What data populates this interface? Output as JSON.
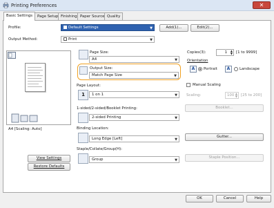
{
  "window": {
    "title": "Printing Preferences",
    "close_glyph": "✕"
  },
  "tabs": [
    {
      "label": "Basic Settings",
      "active": true
    },
    {
      "label": "Page Setup",
      "active": false
    },
    {
      "label": "Finishing",
      "active": false
    },
    {
      "label": "Paper Source",
      "active": false
    },
    {
      "label": "Quality",
      "active": false
    }
  ],
  "profile": {
    "label": "Profile:",
    "value": "Default Settings",
    "add_button": "Add(1)...",
    "edit_button": "Edit(2)..."
  },
  "output_method": {
    "label": "Output Method:",
    "value": "Print"
  },
  "preview": {
    "caption": "A4 [Scaling: Auto]",
    "view_settings_button": "View Settings",
    "restore_defaults_button": "Restore Defaults"
  },
  "page_size": {
    "label": "Page Size:",
    "value": "A4"
  },
  "output_size": {
    "label": "Output Size:",
    "value": "Match Page Size"
  },
  "copies": {
    "label": "Copies(3):",
    "value": "1",
    "range": "[1 to 9999]"
  },
  "orientation": {
    "label": "Orientation",
    "portrait": "Portrait",
    "landscape": "Landscape",
    "selected": "Portrait"
  },
  "page_layout": {
    "label": "Page Layout:",
    "value": "1 on 1"
  },
  "manual_scaling": {
    "label": "Manual Scaling",
    "scaling_label": "Scaling:",
    "value": "100",
    "range": "[25 to 200]"
  },
  "booklet_button": "Booklet...",
  "printing_mode": {
    "label": "1-sided/2-sided/Booklet Printing:",
    "value": "2-sided Printing"
  },
  "binding": {
    "label": "Binding Location:",
    "value": "Long Edge [Left]",
    "gutter_button": "Gutter..."
  },
  "staple": {
    "label": "Staple/Collate/Group(H):",
    "value": "Group",
    "staple_position_button": "Staple Position..."
  },
  "footer": {
    "ok": "OK",
    "cancel": "Cancel",
    "help": "Help"
  },
  "colors": {
    "accent": "#1f4f9c",
    "highlight": "#f0a020",
    "titlebar": "#dbe6f4"
  }
}
